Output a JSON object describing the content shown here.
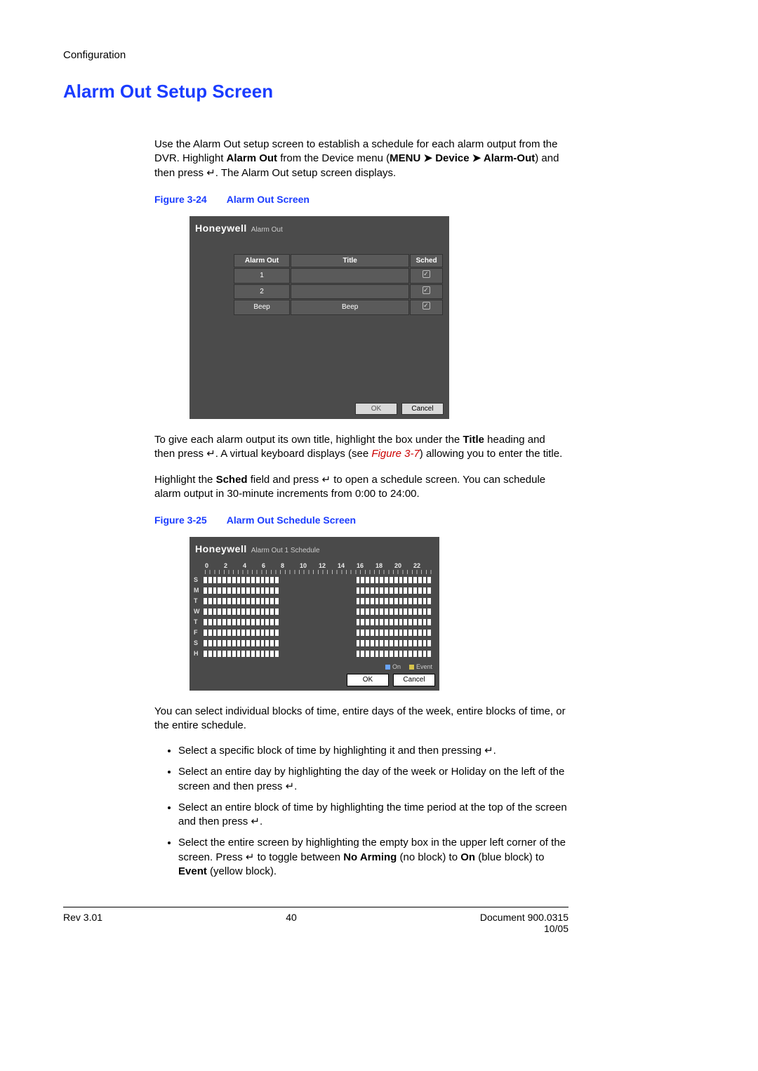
{
  "header": {
    "section": "Configuration"
  },
  "title": "Alarm Out Setup Screen",
  "para1_a": "Use the Alarm Out setup screen to establish a schedule for each alarm output from the DVR. Highlight ",
  "para1_b": "Alarm Out",
  "para1_c": " from the Device menu (",
  "para1_d": "MENU ➤ Device ➤ Alarm-Out",
  "para1_e": ") and then press ",
  "enter": "↵",
  "para1_f": ". The Alarm Out setup screen displays.",
  "fig24": {
    "num": "Figure 3-24",
    "title": "Alarm Out Screen"
  },
  "dlg1": {
    "brand": "Honeywell",
    "title": "Alarm Out",
    "cols": {
      "alarm": "Alarm Out",
      "title": "Title",
      "sched": "Sched"
    },
    "rows": [
      {
        "alarm": "1",
        "title": "",
        "sched": true
      },
      {
        "alarm": "2",
        "title": "",
        "sched": true
      },
      {
        "alarm": "Beep",
        "title": "Beep",
        "sched": true
      }
    ],
    "ok": "OK",
    "cancel": "Cancel"
  },
  "para2_a": "To give each alarm output its own title, highlight the box under the ",
  "para2_b": "Title",
  "para2_c": " heading and then press ",
  "para2_d": ". A virtual keyboard displays (see ",
  "para2_fig": "Figure 3-7",
  "para2_e": ") allowing you to enter the title.",
  "para3_a": "Highlight the ",
  "para3_b": "Sched",
  "para3_c": " field and press ",
  "para3_d": " to open a schedule screen. You can schedule alarm output in 30-minute increments from 0:00 to 24:00.",
  "fig25": {
    "num": "Figure 3-25",
    "title": "Alarm Out Schedule Screen"
  },
  "dlg2": {
    "brand": "Honeywell",
    "title": "Alarm Out 1 Schedule",
    "hours": [
      "0",
      "2",
      "4",
      "6",
      "8",
      "10",
      "12",
      "14",
      "16",
      "18",
      "20",
      "22"
    ],
    "days": [
      "S",
      "M",
      "T",
      "W",
      "T",
      "F",
      "S",
      "H"
    ],
    "pattern": {
      "on_ranges": [
        [
          0,
          16
        ],
        [
          32,
          48
        ]
      ],
      "slots": 48
    },
    "legend_on": "On",
    "legend_event": "Event",
    "ok": "OK",
    "cancel": "Cancel"
  },
  "para4": "You can select individual blocks of time, entire days of the week, entire blocks of time, or the entire schedule.",
  "bullets": {
    "b1_a": "Select a specific block of time by highlighting it and then pressing ",
    "b1_b": ".",
    "b2_a": "Select an entire day by highlighting the day of the week or Holiday on the left of the screen and then press ",
    "b2_b": ".",
    "b3_a": "Select an entire block of time by highlighting the time period at the top of the screen and then press ",
    "b3_b": ".",
    "b4_a": "Select the entire screen by highlighting the empty box in the upper left corner of the screen. Press ",
    "b4_b": " to toggle between ",
    "b4_c": "No Arming",
    "b4_d": " (no block) to ",
    "b4_e": "On",
    "b4_f": " (blue block) to ",
    "b4_g": "Event",
    "b4_h": " (yellow block)."
  },
  "footer": {
    "rev": "Rev 3.01",
    "page": "40",
    "doc": "Document 900.0315",
    "date": "10/05"
  }
}
